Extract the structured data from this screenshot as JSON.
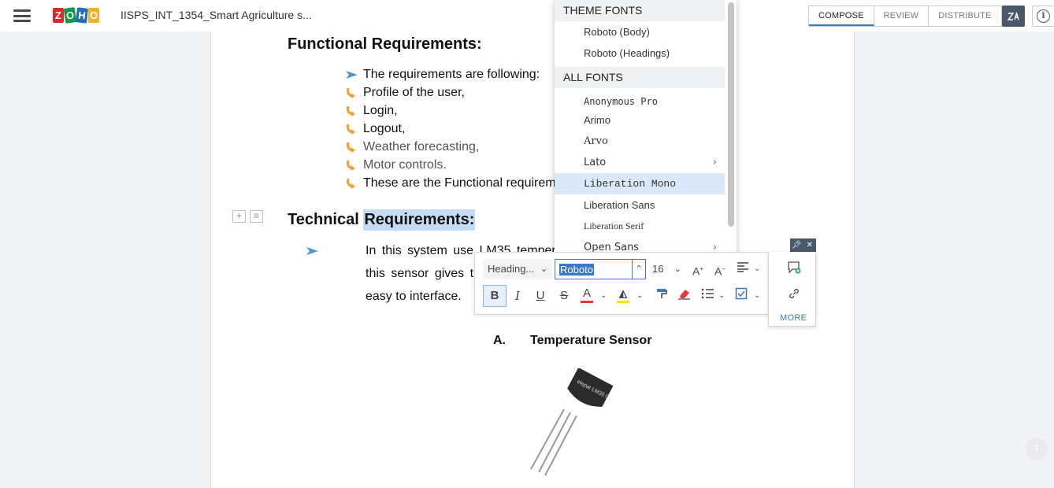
{
  "topbar": {
    "logo_letters": [
      "Z",
      "O",
      "H",
      "O"
    ],
    "logo_colors": [
      "#e42527",
      "#089949",
      "#226db4",
      "#f9b21d"
    ],
    "doc_title": "IISPS_INT_1354_Smart Agriculture s...",
    "tabs": [
      "COMPOSE",
      "REVIEW",
      "DISTRIBUTE"
    ],
    "active_tab": "COMPOSE",
    "zia_label": "Zia"
  },
  "document": {
    "heading1": "Functional Requirements:",
    "bullets": [
      "The requirements are following:",
      "Profile of the user,",
      "Login,",
      "Logout,",
      "Weather forecasting,",
      "Motor controls.",
      "These are the Functional requireme"
    ],
    "heading2_prefix": "Technical ",
    "heading2_selected": "Requirements:",
    "paragraph_lines": [
      "In this system use LM35 temper",
      "this sensor gives t",
      "easy to interface."
    ],
    "caption_letter": "A.",
    "caption_text": "Temperature Sensor",
    "sensor_text": "elepat LM35 01"
  },
  "font_menu": {
    "theme_header": "THEME FONTS",
    "theme_fonts": [
      "Roboto (Body)",
      "Roboto (Headings)"
    ],
    "all_header": "ALL FONTS",
    "all_fonts": [
      "Anonymous Pro",
      "Arimo",
      "Arvo",
      "Lato",
      "Liberation Mono",
      "Liberation Sans",
      "Liberation Serif",
      "Open Sans"
    ],
    "highlighted": "Liberation Mono"
  },
  "format_toolbar": {
    "style_value": "Heading...",
    "font_value": "Roboto",
    "size_value": "16",
    "more_label": "MORE",
    "icons": [
      "font-size-increase-icon",
      "font-size-decrease-icon",
      "align-left-icon",
      "bold-icon",
      "italic-icon",
      "underline-icon",
      "strikethrough-icon",
      "font-color-icon",
      "highlight-icon",
      "format-painter-icon",
      "clear-format-icon",
      "bullet-list-icon",
      "checklist-icon",
      "add-comment-icon",
      "link-icon",
      "pin-icon",
      "close-icon"
    ],
    "accent": "#3a79c8",
    "font_color_bar": "#e53935",
    "highlight_bar": "#f5e50a"
  }
}
